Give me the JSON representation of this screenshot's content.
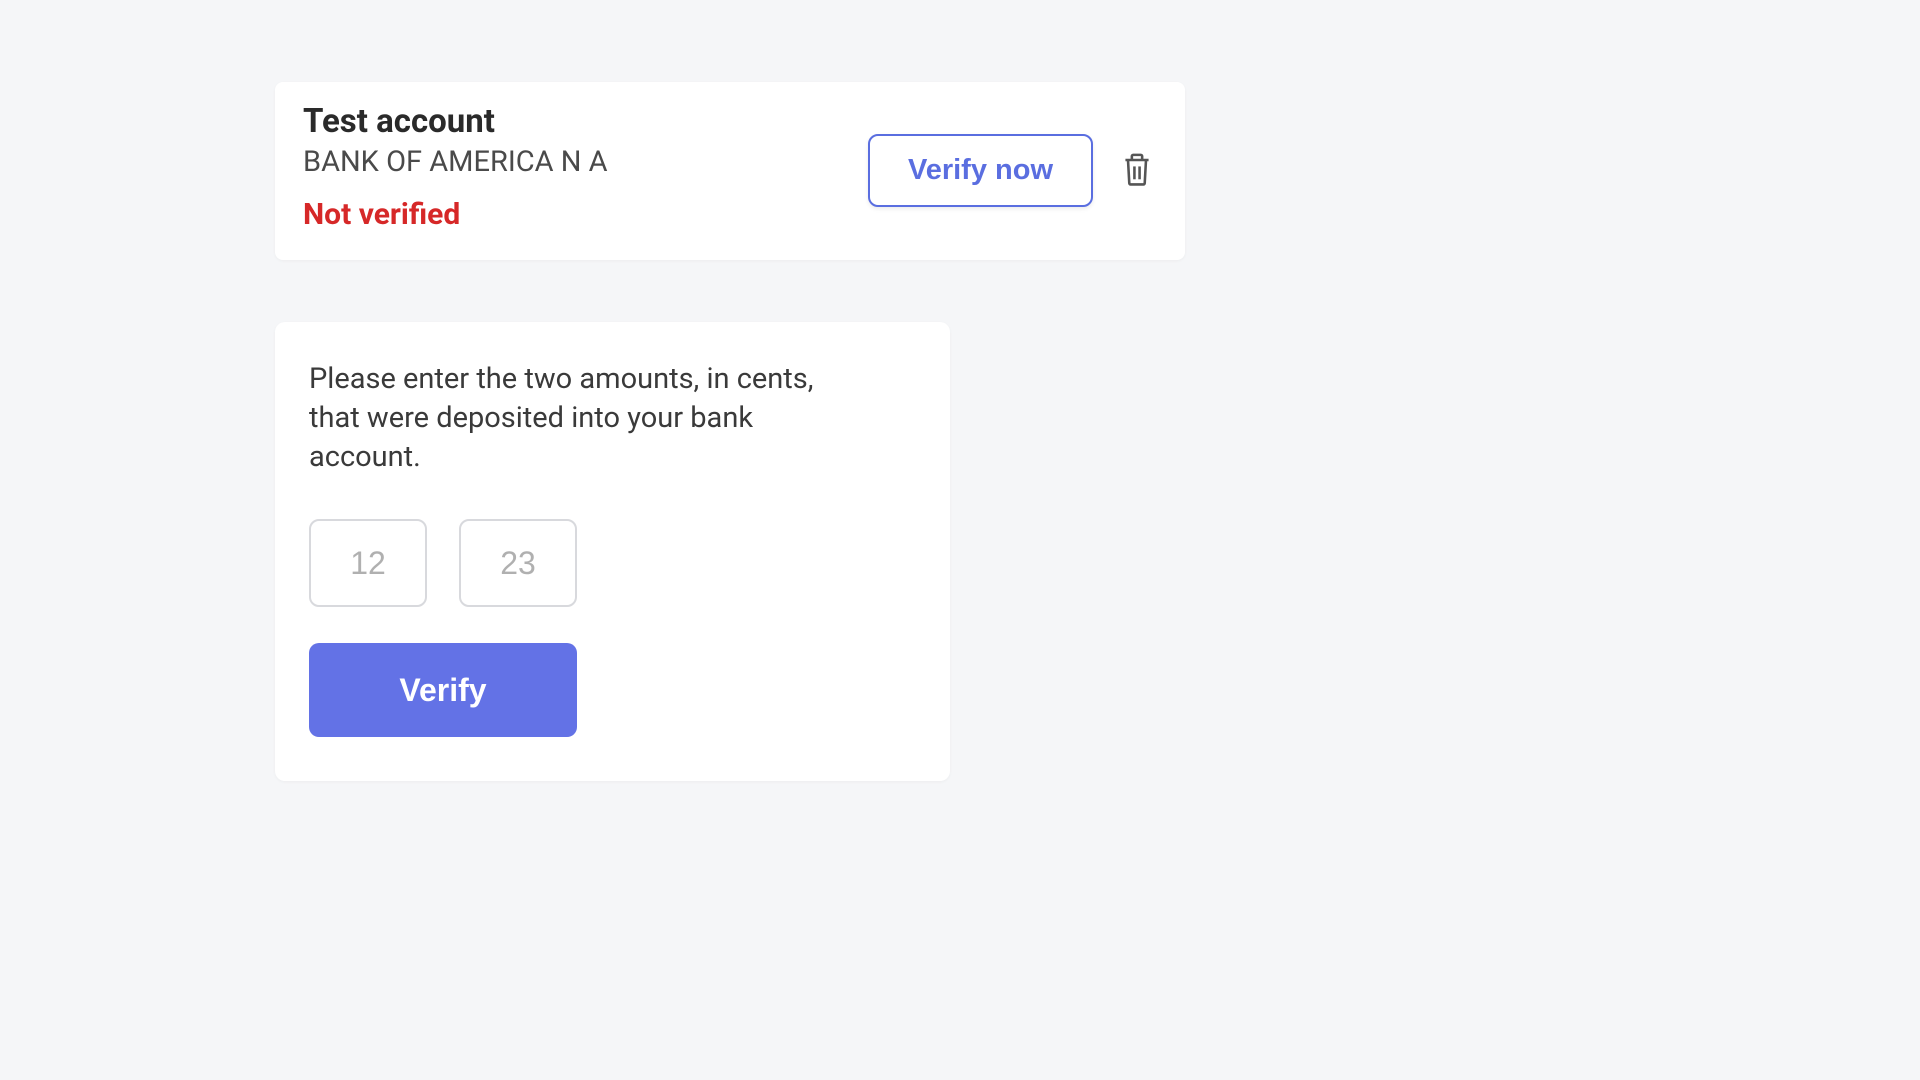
{
  "account": {
    "name": "Test account",
    "bank": "BANK OF AMERICA N A",
    "status": "Not verified",
    "verify_now_label": "Verify now"
  },
  "verification": {
    "instructions": "Please enter the two amounts, in cents, that were deposited into your bank account.",
    "amount1_placeholder": "12",
    "amount2_placeholder": "23",
    "verify_button_label": "Verify"
  },
  "colors": {
    "accent": "#6372e6",
    "error": "#d62828"
  }
}
